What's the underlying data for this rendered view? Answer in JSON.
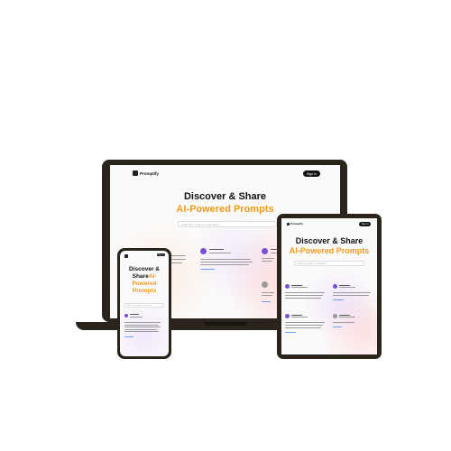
{
  "brand": {
    "name": "Promptify",
    "signin_label": "Sign In"
  },
  "hero": {
    "line1": "Discover & Share",
    "line2": "AI-Powered Prompts"
  },
  "phone_hero": {
    "line1": "Discover &",
    "line2_a": "Share",
    "line2_b": "AI-",
    "line3": "Powered",
    "line4": "Prompts"
  },
  "search": {
    "placeholder": "Search for a tag or a username"
  },
  "colors": {
    "frame": "#2b241c",
    "accent": "#f09a1a",
    "avatar": "#7a4fd4",
    "tag": "#6aa0ff"
  }
}
